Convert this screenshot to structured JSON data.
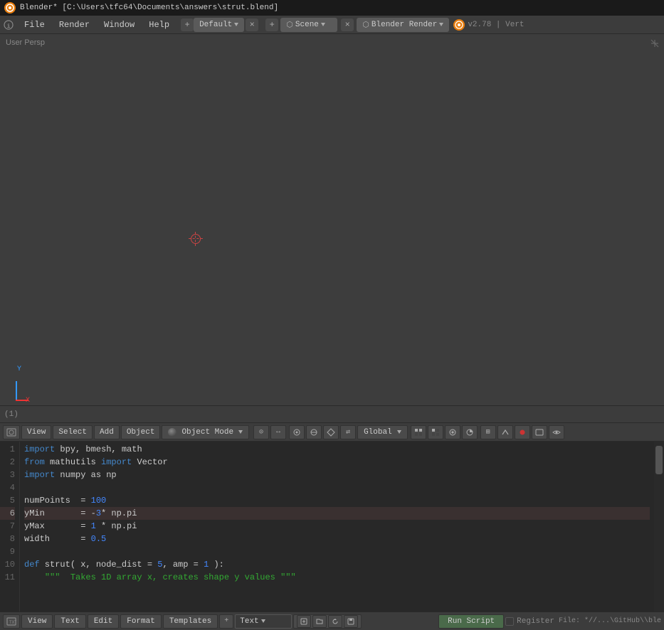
{
  "title_bar": {
    "logo": "B",
    "title": "Blender* [C:\\Users\\tfc64\\Documents\\answers\\strut.blend]"
  },
  "menu_bar": {
    "info_icon": "i",
    "menus": [
      "File",
      "Render",
      "Window",
      "Help"
    ],
    "workspace": {
      "label": "Default",
      "plus_label": "+",
      "x_label": "×"
    },
    "scene": {
      "icon": "⬡",
      "label": "Scene",
      "plus_label": "+",
      "x_label": "×"
    },
    "engine": {
      "icon": "⬡",
      "label": "Blender Render"
    },
    "version": "v2.78 | Vert"
  },
  "viewport": {
    "label": "User Persp",
    "info": "(1)"
  },
  "editor_toolbar": {
    "view_label": "View",
    "select_label": "Select",
    "add_label": "Add",
    "object_label": "Object",
    "mode_label": "Object Mode",
    "global_label": "Global"
  },
  "code_lines": [
    {
      "num": "1",
      "content": "import bpy, bmesh, math",
      "tokens": [
        {
          "t": "kw-import",
          "v": "import"
        },
        {
          "t": "plain",
          "v": " bpy, bmesh, math"
        }
      ]
    },
    {
      "num": "2",
      "content": "from mathutils import Vector",
      "tokens": [
        {
          "t": "kw-from",
          "v": "from"
        },
        {
          "t": "plain",
          "v": " mathutils "
        },
        {
          "t": "kw-import",
          "v": "import"
        },
        {
          "t": "plain",
          "v": " Vector"
        }
      ]
    },
    {
      "num": "3",
      "content": "import numpy as np",
      "tokens": [
        {
          "t": "kw-import",
          "v": "import"
        },
        {
          "t": "plain",
          "v": " numpy as np"
        }
      ]
    },
    {
      "num": "4",
      "content": "",
      "tokens": []
    },
    {
      "num": "5",
      "content": "numPoints  = 100",
      "tokens": [
        {
          "t": "plain",
          "v": "numPoints  = "
        },
        {
          "t": "num",
          "v": "100"
        }
      ]
    },
    {
      "num": "6",
      "content": "yMin       = -3* np.pi",
      "tokens": [
        {
          "t": "plain",
          "v": "yMin       = -"
        },
        {
          "t": "num",
          "v": "3"
        },
        {
          "t": "plain",
          "v": "* np.pi"
        }
      ],
      "highlight": true
    },
    {
      "num": "7",
      "content": "yMax       = 1 * np.pi",
      "tokens": [
        {
          "t": "plain",
          "v": "yMax       = "
        },
        {
          "t": "num",
          "v": "1"
        },
        {
          "t": "plain",
          "v": " * np.pi"
        }
      ]
    },
    {
      "num": "8",
      "content": "width      = 0.5",
      "tokens": [
        {
          "t": "plain",
          "v": "width      = "
        },
        {
          "t": "num",
          "v": "0.5"
        }
      ]
    },
    {
      "num": "9",
      "content": "",
      "tokens": []
    },
    {
      "num": "10",
      "content": "def strut( x, node_dist = 5, amp = 1 ):",
      "tokens": [
        {
          "t": "kw-def",
          "v": "def"
        },
        {
          "t": "plain",
          "v": " strut( x, node_dist = "
        },
        {
          "t": "num",
          "v": "5"
        },
        {
          "t": "plain",
          "v": ", amp = "
        },
        {
          "t": "num",
          "v": "1"
        },
        {
          "t": "plain",
          "v": " ):"
        }
      ]
    },
    {
      "num": "11",
      "content": "    \"\"\" Takes 1D array x, creates shape y values \"\"\"",
      "tokens": [
        {
          "t": "plain",
          "v": "    "
        },
        {
          "t": "kw-str",
          "v": "\"\"\" Takes 1D array x, creates shape y values \"\"\""
        }
      ]
    }
  ],
  "bottom_bar": {
    "view_label": "View",
    "text_label": "Text",
    "edit_label": "Edit",
    "format_label": "Format",
    "templates_label": "Templates",
    "text_field_label": "Text",
    "run_script_label": "Run Script",
    "register_label": "Register",
    "file_path": "File: *//...\\GitHub\\\\ble"
  }
}
